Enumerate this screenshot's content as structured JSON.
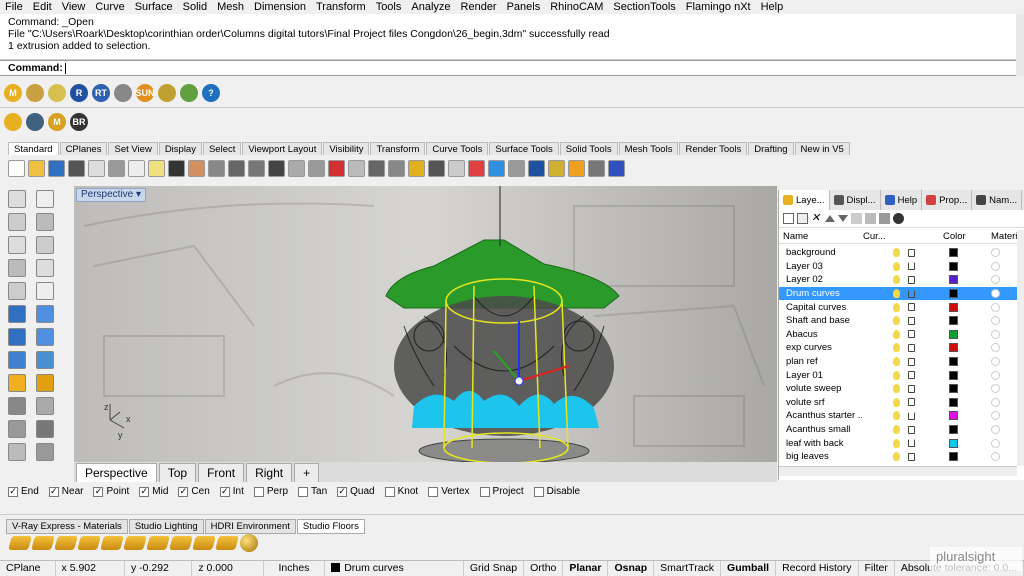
{
  "menu": [
    "File",
    "Edit",
    "View",
    "Curve",
    "Surface",
    "Solid",
    "Mesh",
    "Dimension",
    "Transform",
    "Tools",
    "Analyze",
    "Render",
    "Panels",
    "RhinoCAM",
    "SectionTools",
    "Flamingo nXt",
    "Help"
  ],
  "command_history": [
    "Command: _Open",
    "File \"C:\\Users\\Roark\\Desktop\\corinthian order\\Columns digital tutors\\Final Project files Congdon\\26_begin.3dm\" successfully read",
    "1 extrusion added to selection."
  ],
  "command_prompt": "Command:",
  "plugin_bar_1": [
    "M",
    "",
    "",
    "R",
    "RT",
    "",
    "SUN",
    "",
    "",
    "?"
  ],
  "plugin_bar_2": [
    "",
    "",
    "M",
    "BR"
  ],
  "toolbar_tabs": [
    "Standard",
    "CPlanes",
    "Set View",
    "Display",
    "Select",
    "Viewport Layout",
    "Visibility",
    "Transform",
    "Curve Tools",
    "Surface Tools",
    "Solid Tools",
    "Mesh Tools",
    "Render Tools",
    "Drafting",
    "New in V5"
  ],
  "active_toolbar_tab": "Standard",
  "viewport": {
    "label": "Perspective",
    "axis_labels": {
      "z": "z",
      "x": "x",
      "y": "y"
    }
  },
  "viewport_tabs": [
    "Perspective",
    "Top",
    "Front",
    "Right",
    "+"
  ],
  "osnaps": [
    {
      "label": "End",
      "checked": true
    },
    {
      "label": "Near",
      "checked": true
    },
    {
      "label": "Point",
      "checked": true
    },
    {
      "label": "Mid",
      "checked": true
    },
    {
      "label": "Cen",
      "checked": true
    },
    {
      "label": "Int",
      "checked": true
    },
    {
      "label": "Perp",
      "checked": false
    },
    {
      "label": "Tan",
      "checked": false
    },
    {
      "label": "Quad",
      "checked": true
    },
    {
      "label": "Knot",
      "checked": false
    },
    {
      "label": "Vertex",
      "checked": false
    },
    {
      "label": "Project",
      "checked": false
    },
    {
      "label": "Disable",
      "checked": false
    }
  ],
  "bottom_tabs": [
    "V-Ray Express - Materials",
    "Studio Lighting",
    "HDRI Environment",
    "Studio Floors"
  ],
  "active_bottom_tab": "Studio Floors",
  "panel": {
    "tabs": [
      "Laye...",
      "Displ...",
      "Help",
      "Prop...",
      "Nam..."
    ],
    "columns": [
      "Name",
      "Cur...",
      "Color",
      "Materi"
    ],
    "layers": [
      {
        "name": "background",
        "color": "#000000",
        "locked": true,
        "selected": false
      },
      {
        "name": "Layer 03",
        "color": "#000000",
        "locked": false,
        "selected": false
      },
      {
        "name": "Layer 02",
        "color": "#5b1ecc",
        "locked": true,
        "selected": false
      },
      {
        "name": "Drum curves",
        "color": "#000000",
        "locked": false,
        "selected": true
      },
      {
        "name": "Capital curves",
        "color": "#d01010",
        "locked": true,
        "selected": false
      },
      {
        "name": "Shaft and base",
        "color": "#000000",
        "locked": true,
        "selected": false
      },
      {
        "name": "Abacus",
        "color": "#11a030",
        "locked": true,
        "selected": false
      },
      {
        "name": "exp curves",
        "color": "#d01010",
        "locked": true,
        "selected": false
      },
      {
        "name": "plan ref",
        "color": "#000000",
        "locked": true,
        "selected": false
      },
      {
        "name": "Layer 01",
        "color": "#000000",
        "locked": true,
        "selected": false
      },
      {
        "name": "volute sweep",
        "color": "#000000",
        "locked": true,
        "selected": false
      },
      {
        "name": "volute srf",
        "color": "#000000",
        "locked": true,
        "selected": false
      },
      {
        "name": "Acanthus starter ...",
        "color": "#e010e0",
        "locked": false,
        "selected": false
      },
      {
        "name": "Acanthus small",
        "color": "#000000",
        "locked": true,
        "selected": false
      },
      {
        "name": "leaf with back",
        "color": "#10c8e8",
        "locked": false,
        "selected": false
      },
      {
        "name": "big leaves",
        "color": "#000000",
        "locked": true,
        "selected": false
      }
    ]
  },
  "status": {
    "cplane": "CPlane",
    "x": "x 5.902",
    "y": "y -0.292",
    "z": "z 0.000",
    "units": "Inches",
    "current_layer": "Drum curves",
    "toggles": [
      {
        "label": "Grid Snap",
        "on": false
      },
      {
        "label": "Ortho",
        "on": false
      },
      {
        "label": "Planar",
        "on": true
      },
      {
        "label": "Osnap",
        "on": true
      },
      {
        "label": "SmartTrack",
        "on": false
      },
      {
        "label": "Gumball",
        "on": true
      },
      {
        "label": "Record History",
        "on": false
      },
      {
        "label": "Filter",
        "on": false
      },
      {
        "label": "Absolute tolerance: 0.0...",
        "on": false
      }
    ]
  },
  "watermark": "pluralsight"
}
